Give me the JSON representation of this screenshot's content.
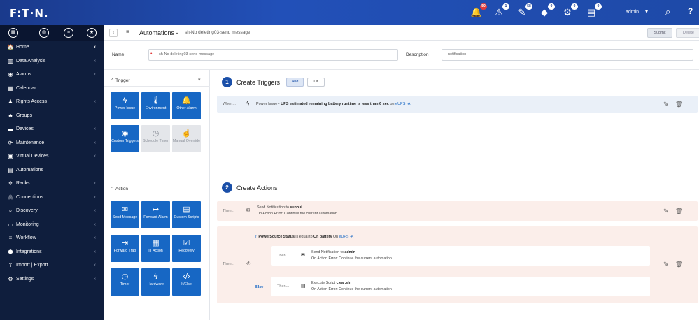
{
  "topbar": {
    "logo": "F:T·N.",
    "icons": [
      {
        "name": "alarm-bell-icon",
        "glyph": "🔔",
        "badge": "50"
      },
      {
        "name": "warning-icon",
        "glyph": "⚠",
        "badge": "1"
      },
      {
        "name": "tag-icon",
        "glyph": "✎",
        "badge": "58"
      },
      {
        "name": "security-tag-icon",
        "glyph": "◆",
        "badge": "0"
      },
      {
        "name": "settings-badge-icon",
        "glyph": "⚙",
        "badge": "0"
      },
      {
        "name": "notes-icon",
        "glyph": "▤",
        "badge": "0"
      }
    ],
    "user": "admin"
  },
  "sidebar": {
    "items": [
      {
        "label": "Home",
        "icon": "🏠"
      },
      {
        "label": "Data Analysis",
        "icon": "▥"
      },
      {
        "label": "Alarms",
        "icon": "◉"
      },
      {
        "label": "Calendar",
        "icon": "▦"
      },
      {
        "label": "Rights Access",
        "icon": "♟"
      },
      {
        "label": "Groups",
        "icon": "♣"
      },
      {
        "label": "Devices",
        "icon": "▬"
      },
      {
        "label": "Maintenance",
        "icon": "⟳"
      },
      {
        "label": "Virtual Devices",
        "icon": "▣"
      },
      {
        "label": "Automations",
        "icon": "▤"
      },
      {
        "label": "Racks",
        "icon": "✲"
      },
      {
        "label": "Connections",
        "icon": "⁂"
      },
      {
        "label": "Discovery",
        "icon": "⌕"
      },
      {
        "label": "Monitoring",
        "icon": "▭"
      },
      {
        "label": "Workflow",
        "icon": "≡"
      },
      {
        "label": "Integrations",
        "icon": "⬢"
      },
      {
        "label": "Import | Export",
        "icon": "⇪"
      },
      {
        "label": "Settings",
        "icon": "⚙"
      }
    ]
  },
  "header": {
    "title": "Automations -",
    "subtitle": "sh-No deleting03-send message",
    "submit_label": "Submit",
    "delete_label": "Delete"
  },
  "form": {
    "name_label": "Name",
    "name_value": "sh-No deleting03-send message",
    "description_label": "Description",
    "description_value": "notification"
  },
  "palette": {
    "trigger_header": "Trigger",
    "action_header": "Action",
    "triggers": [
      {
        "label": "Power Issue",
        "icon": "ϟ",
        "enabled": true
      },
      {
        "label": "Environment",
        "icon": "🌡",
        "enabled": true
      },
      {
        "label": "Other Alarm",
        "icon": "🔔",
        "enabled": true
      },
      {
        "label": "Custom Triggers",
        "icon": "◉",
        "enabled": true
      },
      {
        "label": "Schedule Timer",
        "icon": "◷",
        "enabled": false
      },
      {
        "label": "Manual Override",
        "icon": "☝",
        "enabled": false
      }
    ],
    "actions": [
      {
        "label": "Send Message",
        "icon": "✉"
      },
      {
        "label": "Forward Alarm",
        "icon": "↦"
      },
      {
        "label": "Custom Scripts",
        "icon": "▤"
      },
      {
        "label": "Forward Trap",
        "icon": "⇥"
      },
      {
        "label": "IT Action",
        "icon": "▦"
      },
      {
        "label": "Recovery",
        "icon": "☑"
      },
      {
        "label": "Timer",
        "icon": "◷"
      },
      {
        "label": "Hardware",
        "icon": "ϟ"
      },
      {
        "label": "If/Else",
        "icon": "‹/›"
      }
    ]
  },
  "triggers_section": {
    "step": "1",
    "title": "Create Triggers",
    "and_label": "And",
    "or_label": "Or",
    "when_label": "When...",
    "rule_source": "Power Issue - ",
    "rule_text": "UPS estimated remaining battery runtime is less than 6 sec",
    "rule_on": " on ",
    "rule_device": "eUPS -A"
  },
  "actions_section": {
    "step": "2",
    "title": "Create Actions",
    "then_label": "Then...",
    "action1_prefix": "Send Notification to ",
    "action1_target": "sunhui",
    "on_error_text": "On Action Error: Continue the current automation",
    "if_prefix": "If ",
    "if_condition": "PowerSource Status",
    "if_middle": " is equal to ",
    "if_value": "On battery",
    "if_on": " On ",
    "if_device": "eUPS -A",
    "inner_then_prefix": "Send Notification to ",
    "inner_then_target": "admin",
    "else_label": "Else",
    "else_prefix": "Execute Script ",
    "else_target": "clear.sh"
  }
}
